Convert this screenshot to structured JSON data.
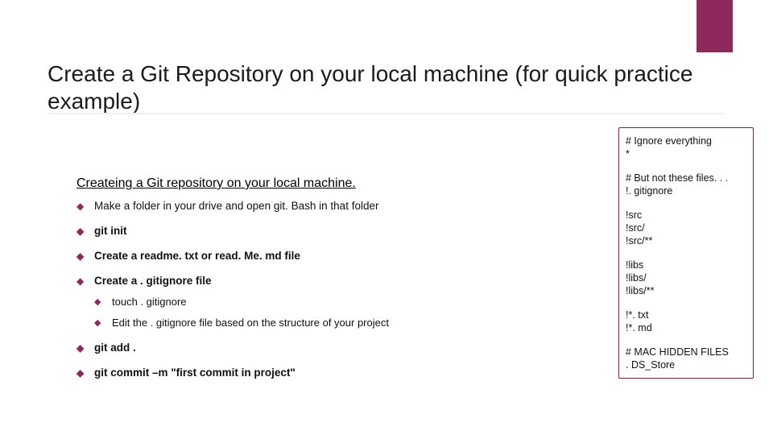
{
  "title": "Create a Git Repository on your local machine (for quick practice example)",
  "subtitle": "Createing a Git repository on your local machine.",
  "steps": {
    "s0": "Make a folder in your drive and open git. Bash in that folder",
    "s1": "git init",
    "s2": "Create a readme. txt or read. Me. md file",
    "s3": "Create a . gitignore file",
    "s3a": "touch . gitignore",
    "s3b": "Edit the . gitignore file based on the structure of your project",
    "s4": "git add .",
    "s5": "git commit –m \"first commit in project\""
  },
  "gitignore": {
    "b0": "# Ignore everything\n*",
    "b1": "# But not these files. . .\n!. gitignore",
    "b2": "!src\n!src/\n!src/**",
    "b3": "!libs\n!libs/\n!libs/**",
    "b4": "!*. txt\n!*. md",
    "b5": "# MAC HIDDEN FILES\n. DS_Store"
  },
  "accent_color": "#8e2a5b"
}
